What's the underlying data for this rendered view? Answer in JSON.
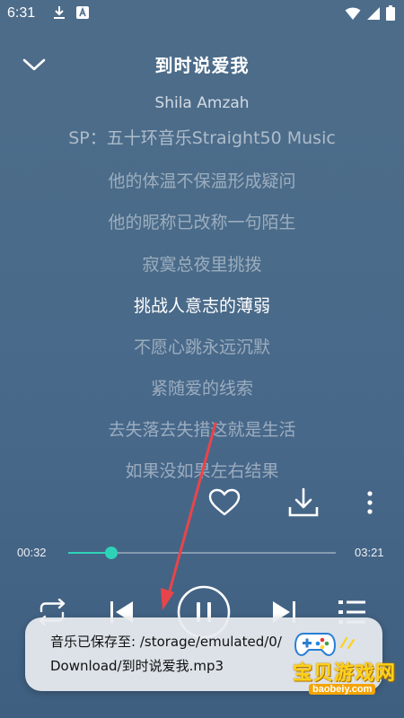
{
  "status_bar": {
    "time": "6:31",
    "icons_left": [
      "download-icon",
      "a-box-icon"
    ],
    "icons_right": [
      "wifi-icon",
      "signal-icon",
      "battery-icon"
    ]
  },
  "header": {
    "title": "到时说爱我",
    "collapse_icon": "chevron-down-icon"
  },
  "lyrics": {
    "artist": "Shila Amzah",
    "lines": [
      "SP：五十环音乐Straight50 Music",
      "他的体温不保温形成疑问",
      "他的昵称已改称一句陌生",
      "寂寞总夜里挑拨",
      "挑战人意志的薄弱",
      "不愿心跳永远沉默",
      "紧随爱的线索",
      "去失落去失措这就是生活",
      "如果没如果左右结果"
    ],
    "active_index": 4
  },
  "actions": {
    "favorite_icon": "heart-icon",
    "download_icon": "download-icon",
    "more_icon": "more-vertical-icon"
  },
  "progress": {
    "current": "00:32",
    "total": "03:21",
    "fraction": 0.16,
    "accent": "#2ed3b7"
  },
  "controls": {
    "repeat_icon": "repeat-icon",
    "previous_icon": "skip-previous-icon",
    "pause_icon": "pause-icon",
    "next_icon": "skip-next-icon",
    "playlist_icon": "playlist-icon"
  },
  "toast": {
    "line1": "音乐已保存至: /storage/emulated/0/",
    "line2": "Download/到时说爱我.mp3"
  },
  "watermark": {
    "text": "宝贝游戏网",
    "url": "baobeiy.com",
    "color": "#ffd21a"
  },
  "annotation": {
    "arrow_color": "#e8454a"
  }
}
